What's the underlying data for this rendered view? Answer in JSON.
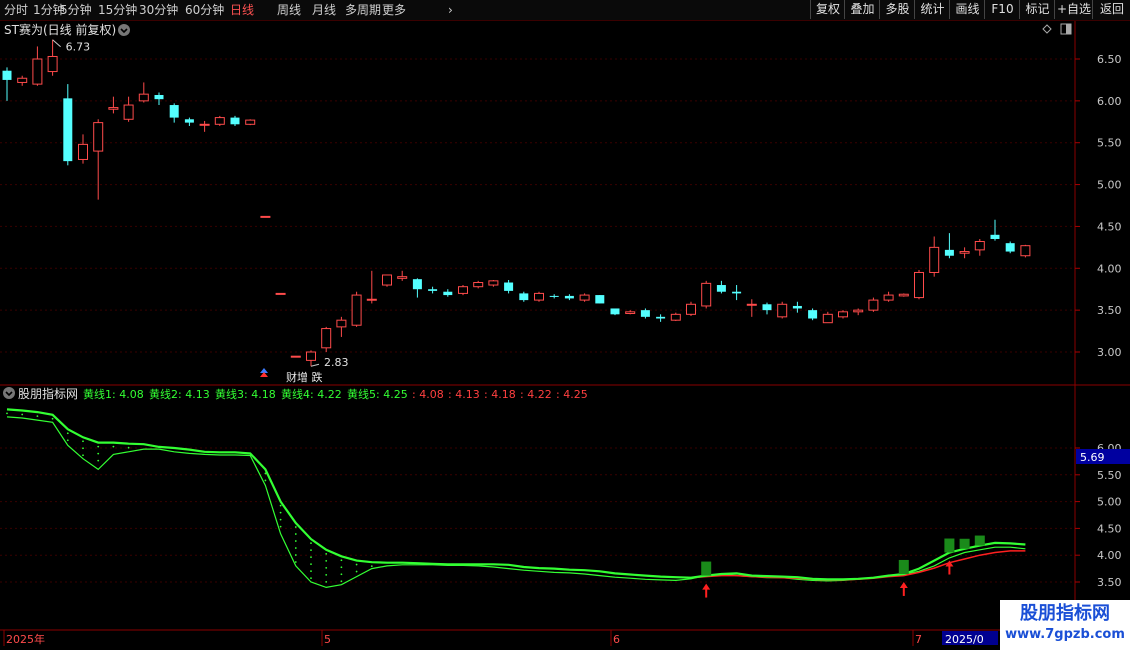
{
  "toolbar": {
    "periods": [
      "分时",
      "1分钟",
      "5分钟",
      "15分钟",
      "30分钟",
      "60分钟",
      "日线",
      "周线",
      "月线",
      "多周期",
      "更多"
    ],
    "active_period": "日线",
    "more_arrow": "›",
    "right_buttons": [
      "复权",
      "叠加",
      "多股",
      "统计",
      "画线",
      "F10",
      "标记",
      "+自选",
      "返回"
    ]
  },
  "main_chart": {
    "title": "ST赛为(日线 前复权)",
    "high_label": "6.73",
    "low_label": "2.83",
    "event_label": "财增 跌",
    "y_ticks": [
      "6.50",
      "6.00",
      "5.50",
      "5.00",
      "4.50",
      "4.00",
      "3.50",
      "3.00"
    ]
  },
  "indicator": {
    "name": "股朋指标网",
    "lines": [
      {
        "label": "黄线1: 4.08"
      },
      {
        "label": "黄线2: 4.13"
      },
      {
        "label": "黄线3: 4.18"
      },
      {
        "label": "黄线4: 4.22"
      },
      {
        "label": "黄线5: 4.25"
      }
    ],
    "red_values": [
      ": 4.08",
      ": 4.13",
      ": 4.18",
      ": 4.22",
      ": 4.25"
    ],
    "y_ticks": [
      "6.00",
      "5.50",
      "5.00",
      "4.50",
      "4.00",
      "3.50"
    ],
    "current_value": "5.69"
  },
  "x_axis": {
    "labels": [
      "2025年",
      "5",
      "6",
      "7"
    ],
    "cursor_date": "2025/0"
  },
  "brand": {
    "title": "股朋指标网",
    "url": "www.7gpzb.com"
  },
  "colors": {
    "up": "#ff4b4b",
    "down": "#54ffff",
    "line_green": "#33ff33",
    "line_red": "#ff2020",
    "grid": "#3a0000"
  },
  "chart_data": {
    "type": "candlestick",
    "x_ticks": [
      "2025年",
      "5",
      "6",
      "7"
    ],
    "y_range": [
      2.6,
      6.8
    ],
    "candles": [
      {
        "o": 6.36,
        "h": 6.4,
        "l": 6.0,
        "c": 6.25
      },
      {
        "o": 6.22,
        "h": 6.3,
        "l": 6.18,
        "c": 6.27
      },
      {
        "o": 6.2,
        "h": 6.65,
        "l": 6.18,
        "c": 6.5
      },
      {
        "o": 6.35,
        "h": 6.73,
        "l": 6.3,
        "c": 6.53
      },
      {
        "o": 6.03,
        "h": 6.2,
        "l": 5.23,
        "c": 5.28
      },
      {
        "o": 5.3,
        "h": 5.6,
        "l": 5.25,
        "c": 5.48
      },
      {
        "o": 5.4,
        "h": 5.78,
        "l": 4.82,
        "c": 5.74
      },
      {
        "o": 5.9,
        "h": 6.05,
        "l": 5.85,
        "c": 5.92
      },
      {
        "o": 5.78,
        "h": 6.05,
        "l": 5.75,
        "c": 5.95
      },
      {
        "o": 6.0,
        "h": 6.22,
        "l": 5.98,
        "c": 6.08
      },
      {
        "o": 6.07,
        "h": 6.1,
        "l": 5.95,
        "c": 6.02
      },
      {
        "o": 5.95,
        "h": 5.97,
        "l": 5.74,
        "c": 5.8
      },
      {
        "o": 5.78,
        "h": 5.8,
        "l": 5.7,
        "c": 5.74
      },
      {
        "o": 5.72,
        "h": 5.76,
        "l": 5.63,
        "c": 5.72
      },
      {
        "o": 5.72,
        "h": 5.82,
        "l": 5.7,
        "c": 5.8
      },
      {
        "o": 5.8,
        "h": 5.82,
        "l": 5.7,
        "c": 5.72
      },
      {
        "o": 5.72,
        "h": 5.78,
        "l": 5.71,
        "c": 5.77
      },
      {
        "o": 4.62,
        "h": 4.62,
        "l": 4.62,
        "c": 4.62
      },
      {
        "o": 3.7,
        "h": 3.7,
        "l": 3.7,
        "c": 3.7
      },
      {
        "o": 2.95,
        "h": 2.95,
        "l": 2.95,
        "c": 2.95
      },
      {
        "o": 2.9,
        "h": 3.02,
        "l": 2.83,
        "c": 3.0
      },
      {
        "o": 3.05,
        "h": 3.3,
        "l": 3.0,
        "c": 3.28
      },
      {
        "o": 3.3,
        "h": 3.42,
        "l": 3.18,
        "c": 3.38
      },
      {
        "o": 3.32,
        "h": 3.72,
        "l": 3.3,
        "c": 3.68
      },
      {
        "o": 3.62,
        "h": 3.97,
        "l": 3.58,
        "c": 3.63
      },
      {
        "o": 3.8,
        "h": 3.92,
        "l": 3.78,
        "c": 3.92
      },
      {
        "o": 3.88,
        "h": 3.97,
        "l": 3.85,
        "c": 3.9
      },
      {
        "o": 3.87,
        "h": 3.88,
        "l": 3.65,
        "c": 3.75
      },
      {
        "o": 3.75,
        "h": 3.78,
        "l": 3.7,
        "c": 3.73
      },
      {
        "o": 3.72,
        "h": 3.75,
        "l": 3.66,
        "c": 3.68
      },
      {
        "o": 3.7,
        "h": 3.8,
        "l": 3.68,
        "c": 3.78
      },
      {
        "o": 3.78,
        "h": 3.85,
        "l": 3.76,
        "c": 3.83
      },
      {
        "o": 3.8,
        "h": 3.86,
        "l": 3.78,
        "c": 3.85
      },
      {
        "o": 3.83,
        "h": 3.86,
        "l": 3.7,
        "c": 3.73
      },
      {
        "o": 3.7,
        "h": 3.72,
        "l": 3.6,
        "c": 3.62
      },
      {
        "o": 3.62,
        "h": 3.72,
        "l": 3.6,
        "c": 3.7
      },
      {
        "o": 3.67,
        "h": 3.69,
        "l": 3.64,
        "c": 3.66
      },
      {
        "o": 3.67,
        "h": 3.69,
        "l": 3.62,
        "c": 3.64
      },
      {
        "o": 3.62,
        "h": 3.7,
        "l": 3.6,
        "c": 3.68
      },
      {
        "o": 3.68,
        "h": 3.68,
        "l": 3.58,
        "c": 3.58
      },
      {
        "o": 3.52,
        "h": 3.52,
        "l": 3.44,
        "c": 3.45
      },
      {
        "o": 3.46,
        "h": 3.5,
        "l": 3.45,
        "c": 3.48
      },
      {
        "o": 3.5,
        "h": 3.52,
        "l": 3.4,
        "c": 3.42
      },
      {
        "o": 3.42,
        "h": 3.45,
        "l": 3.36,
        "c": 3.4
      },
      {
        "o": 3.38,
        "h": 3.47,
        "l": 3.37,
        "c": 3.45
      },
      {
        "o": 3.45,
        "h": 3.6,
        "l": 3.43,
        "c": 3.57
      },
      {
        "o": 3.55,
        "h": 3.85,
        "l": 3.52,
        "c": 3.82
      },
      {
        "o": 3.8,
        "h": 3.85,
        "l": 3.7,
        "c": 3.72
      },
      {
        "o": 3.72,
        "h": 3.8,
        "l": 3.62,
        "c": 3.7
      },
      {
        "o": 3.57,
        "h": 3.63,
        "l": 3.42,
        "c": 3.57
      },
      {
        "o": 3.57,
        "h": 3.59,
        "l": 3.45,
        "c": 3.5
      },
      {
        "o": 3.42,
        "h": 3.6,
        "l": 3.4,
        "c": 3.57
      },
      {
        "o": 3.55,
        "h": 3.6,
        "l": 3.47,
        "c": 3.52
      },
      {
        "o": 3.5,
        "h": 3.52,
        "l": 3.38,
        "c": 3.4
      },
      {
        "o": 3.35,
        "h": 3.48,
        "l": 3.35,
        "c": 3.45
      },
      {
        "o": 3.42,
        "h": 3.5,
        "l": 3.4,
        "c": 3.48
      },
      {
        "o": 3.48,
        "h": 3.52,
        "l": 3.44,
        "c": 3.5
      },
      {
        "o": 3.5,
        "h": 3.65,
        "l": 3.48,
        "c": 3.62
      },
      {
        "o": 3.62,
        "h": 3.72,
        "l": 3.6,
        "c": 3.68
      },
      {
        "o": 3.67,
        "h": 3.7,
        "l": 3.66,
        "c": 3.69
      },
      {
        "o": 3.65,
        "h": 3.98,
        "l": 3.63,
        "c": 3.95
      },
      {
        "o": 3.95,
        "h": 4.38,
        "l": 3.9,
        "c": 4.25
      },
      {
        "o": 4.22,
        "h": 4.42,
        "l": 4.12,
        "c": 4.15
      },
      {
        "o": 4.18,
        "h": 4.25,
        "l": 4.12,
        "c": 4.2
      },
      {
        "o": 4.22,
        "h": 4.35,
        "l": 4.15,
        "c": 4.32
      },
      {
        "o": 4.4,
        "h": 4.58,
        "l": 4.33,
        "c": 4.35
      },
      {
        "o": 4.3,
        "h": 4.32,
        "l": 4.18,
        "c": 4.2
      },
      {
        "o": 4.15,
        "h": 4.28,
        "l": 4.13,
        "c": 4.27
      }
    ],
    "indicator_green_upper": [
      6.72,
      6.7,
      6.67,
      6.62,
      6.35,
      6.2,
      6.1,
      6.1,
      6.08,
      6.07,
      6.02,
      6.0,
      5.97,
      5.93,
      5.92,
      5.92,
      5.9,
      5.6,
      5.0,
      4.6,
      4.3,
      4.1,
      3.98,
      3.9,
      3.87,
      3.86,
      3.86,
      3.85,
      3.84,
      3.83,
      3.83,
      3.83,
      3.83,
      3.82,
      3.78,
      3.76,
      3.75,
      3.73,
      3.72,
      3.7,
      3.66,
      3.64,
      3.62,
      3.6,
      3.59,
      3.58,
      3.62,
      3.65,
      3.66,
      3.62,
      3.61,
      3.6,
      3.59,
      3.56,
      3.55,
      3.55,
      3.56,
      3.58,
      3.62,
      3.65,
      3.75,
      3.9,
      4.05,
      4.12,
      4.18,
      4.23,
      4.22,
      4.2
    ],
    "indicator_red_lower": [
      null,
      null,
      null,
      null,
      null,
      null,
      null,
      null,
      null,
      null,
      null,
      null,
      null,
      null,
      null,
      null,
      null,
      null,
      null,
      null,
      null,
      null,
      null,
      null,
      null,
      null,
      null,
      null,
      null,
      null,
      null,
      null,
      null,
      null,
      null,
      null,
      null,
      null,
      null,
      null,
      null,
      null,
      null,
      null,
      null,
      3.58,
      3.6,
      3.62,
      3.62,
      3.6,
      3.59,
      3.58,
      3.57,
      3.55,
      3.54,
      3.54,
      3.55,
      3.57,
      3.6,
      3.62,
      3.68,
      3.76,
      3.86,
      3.93,
      4.0,
      4.05,
      4.08,
      4.08
    ],
    "indicator_green_lower": [
      6.58,
      6.56,
      6.52,
      6.48,
      6.05,
      5.8,
      5.6,
      5.88,
      5.93,
      5.98,
      5.98,
      5.93,
      5.9,
      5.88,
      5.87,
      5.87,
      5.86,
      5.3,
      4.4,
      3.8,
      3.5,
      3.4,
      3.45,
      3.6,
      3.75,
      3.8,
      3.82,
      3.82,
      3.82,
      3.81,
      3.81,
      3.8,
      3.78,
      3.75,
      3.72,
      3.7,
      3.68,
      3.67,
      3.65,
      3.62,
      3.59,
      3.57,
      3.55,
      3.54,
      3.53,
      3.56,
      3.62,
      3.65,
      3.62,
      3.6,
      3.58,
      3.58,
      3.55,
      3.53,
      3.52,
      3.53,
      3.55,
      3.58,
      3.62,
      3.64,
      3.7,
      3.8,
      3.95,
      4.05,
      4.1,
      4.15,
      4.15,
      4.12
    ],
    "signal_indices": [
      46,
      59,
      62
    ]
  }
}
